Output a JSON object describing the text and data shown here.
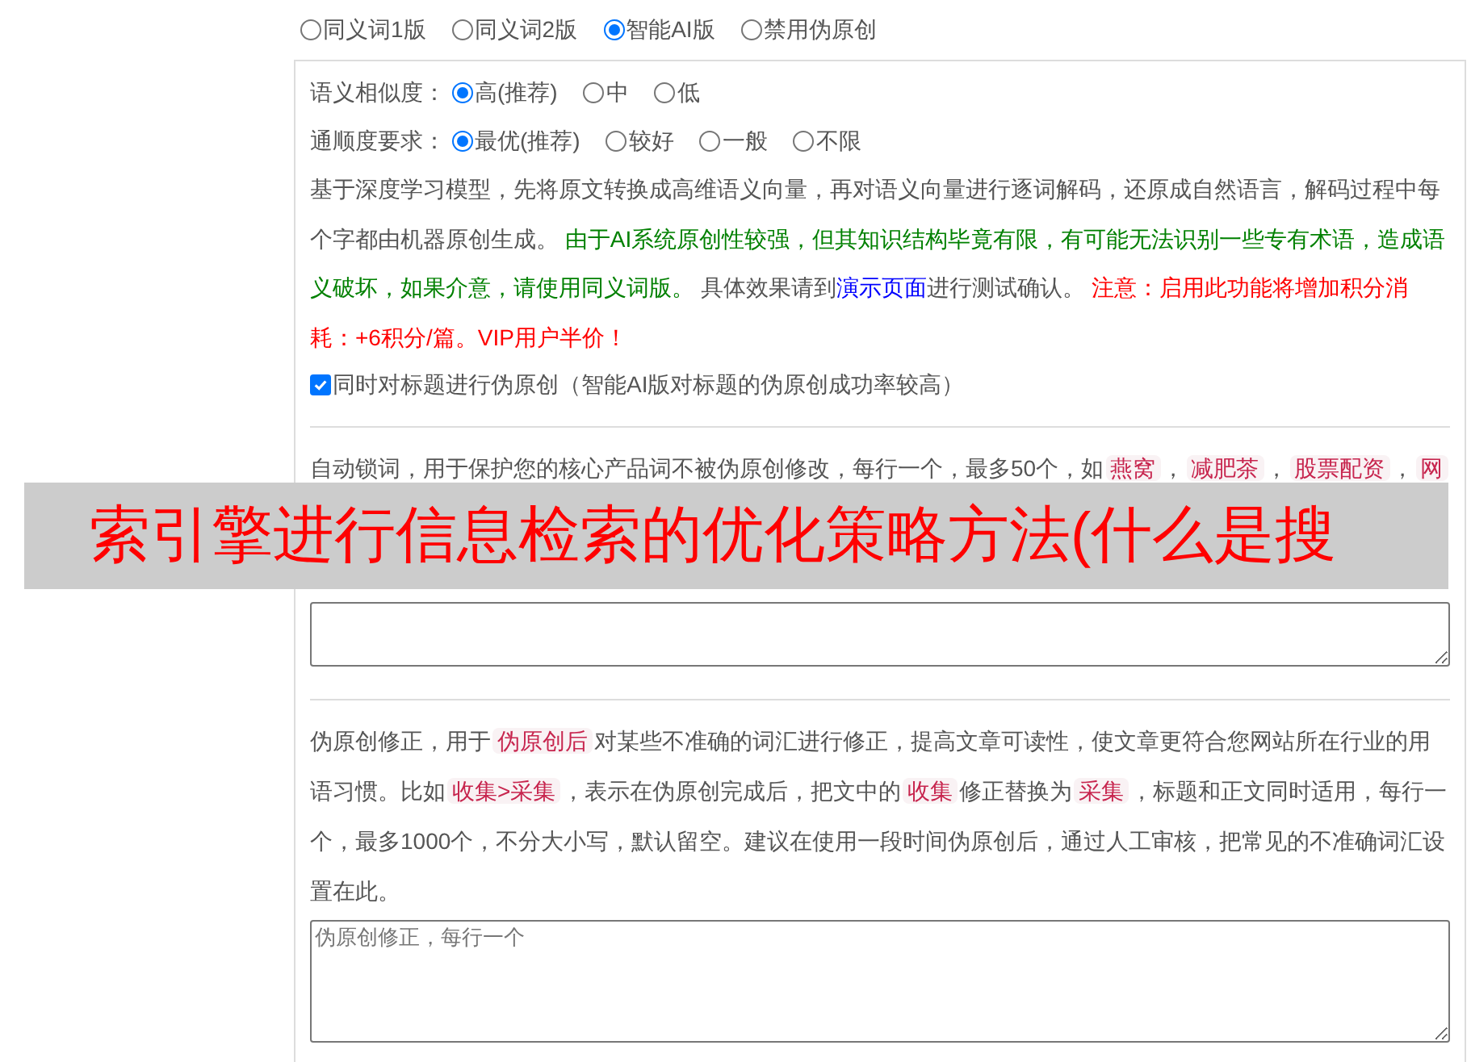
{
  "versions": [
    {
      "label": "同义词1版",
      "selected": false
    },
    {
      "label": "同义词2版",
      "selected": false
    },
    {
      "label": "智能AI版",
      "selected": true
    },
    {
      "label": "禁用伪原创",
      "selected": false
    }
  ],
  "similarity": {
    "label": "语义相似度：",
    "options": [
      {
        "label": "高(推荐)",
        "selected": true
      },
      {
        "label": "中",
        "selected": false
      },
      {
        "label": "低",
        "selected": false
      }
    ]
  },
  "fluency": {
    "label": "通顺度要求：",
    "options": [
      {
        "label": "最优(推荐)",
        "selected": true
      },
      {
        "label": "较好",
        "selected": false
      },
      {
        "label": "一般",
        "selected": false
      },
      {
        "label": "不限",
        "selected": false
      }
    ]
  },
  "description": [
    {
      "kind": "text",
      "text": "基于深度学习模型，先将原文转换成高维语义向量，再对语义向量进行逐词解码，还原成自然语言，解码过程中每个字都由机器原创生成。 "
    },
    {
      "kind": "green",
      "text": "由于AI系统原创性较强，但其知识结构毕竟有限，有可能无法识别一些专有术语，造成语义破坏，如果介意，请使用同义词版。"
    },
    {
      "kind": "text",
      "text": " 具体效果请到"
    },
    {
      "kind": "link",
      "text": "演示页面"
    },
    {
      "kind": "text",
      "text": "进行测试确认。 "
    },
    {
      "kind": "red",
      "text": "注意：启用此功能将增加积分消耗：+6积分/篇。VIP用户半价！"
    }
  ],
  "title_option": {
    "label": "同时对标题进行伪原创（智能AI版对标题的伪原创成功率较高）",
    "checked": true
  },
  "lock_words": {
    "segments": [
      {
        "kind": "text",
        "text": "自动锁词，用于保护您的核心产品词不被伪原创修改，每行一个，最多50个，如"
      },
      {
        "kind": "code",
        "text": "燕窝"
      },
      {
        "kind": "text",
        "text": "，"
      },
      {
        "kind": "code",
        "text": "减肥茶"
      },
      {
        "kind": "text",
        "text": "，"
      },
      {
        "kind": "code",
        "text": "股票配资"
      },
      {
        "kind": "text",
        "text": "，"
      },
      {
        "kind": "code",
        "text": "网"
      }
    ]
  },
  "banner": {
    "text": "索引擎进行信息检索的优化策略方法(什么是搜"
  },
  "correction": {
    "segments": [
      {
        "kind": "text",
        "text": "伪原创修正，用于"
      },
      {
        "kind": "code",
        "text": "伪原创后"
      },
      {
        "kind": "text",
        "text": "对某些不准确的词汇进行修正，提高文章可读性，使文章更符合您网站所在行业的用语习惯。比如"
      },
      {
        "kind": "code",
        "text": "收集>采集"
      },
      {
        "kind": "text",
        "text": "，表示在伪原创完成后，把文中的"
      },
      {
        "kind": "code",
        "text": "收集"
      },
      {
        "kind": "text",
        "text": "修正替换为"
      },
      {
        "kind": "code",
        "text": "采集"
      },
      {
        "kind": "text",
        "text": "，标题和正文同时适用，每行一个，最多1000个，不分大小写，默认留空。建议在使用一段时间伪原创后，通过人工审核，把常见的不准确词汇设置在此。"
      }
    ],
    "placeholder": "伪原创修正，每行一个"
  }
}
